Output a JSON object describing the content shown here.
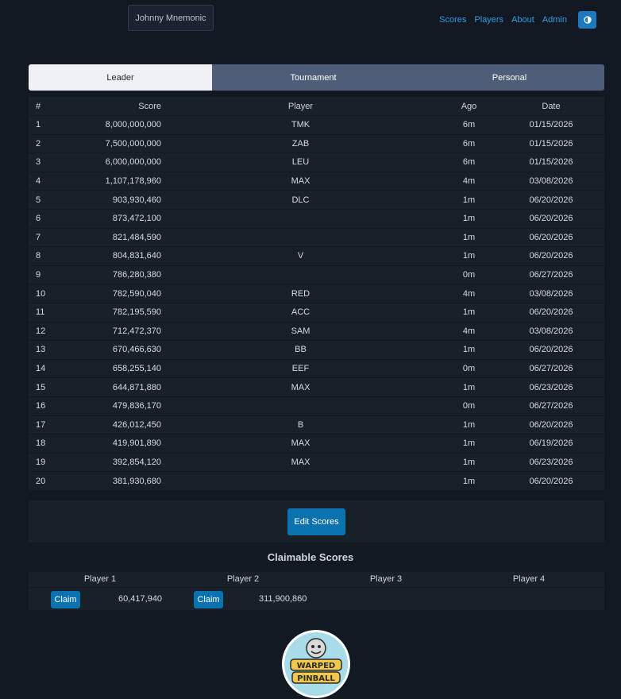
{
  "header": {
    "machine_name": "Johnny Mnemonic",
    "nav": [
      "Scores",
      "Players",
      "About",
      "Admin"
    ],
    "theme_icon": "half-circle-contrast-icon"
  },
  "tabs": [
    {
      "label": "Leader",
      "active": true
    },
    {
      "label": "Tournament",
      "active": false
    },
    {
      "label": "Personal",
      "active": false
    }
  ],
  "table": {
    "columns": [
      "#",
      "Score",
      "Player",
      "Ago",
      "Date"
    ],
    "rows": [
      [
        "1",
        "8,000,000,000",
        "TMK",
        "6m",
        "01/15/2026"
      ],
      [
        "2",
        "7,500,000,000",
        "ZAB",
        "6m",
        "01/15/2026"
      ],
      [
        "3",
        "6,000,000,000",
        "LEU",
        "6m",
        "01/15/2026"
      ],
      [
        "4",
        "1,107,178,960",
        "MAX",
        "4m",
        "03/08/2026"
      ],
      [
        "5",
        "903,930,460",
        "DLC",
        "1m",
        "06/20/2026"
      ],
      [
        "6",
        "873,472,100",
        "",
        "1m",
        "06/20/2026"
      ],
      [
        "7",
        "821,484,590",
        "",
        "1m",
        "06/20/2026"
      ],
      [
        "8",
        "804,831,640",
        "V",
        "1m",
        "06/20/2026"
      ],
      [
        "9",
        "786,280,380",
        "",
        "0m",
        "06/27/2026"
      ],
      [
        "10",
        "782,590,040",
        "RED",
        "4m",
        "03/08/2026"
      ],
      [
        "11",
        "782,195,590",
        "ACC",
        "1m",
        "06/20/2026"
      ],
      [
        "12",
        "712,472,370",
        "SAM",
        "4m",
        "03/08/2026"
      ],
      [
        "13",
        "670,466,630",
        "BB",
        "1m",
        "06/20/2026"
      ],
      [
        "14",
        "658,255,140",
        "EEF",
        "0m",
        "06/27/2026"
      ],
      [
        "15",
        "644,871,880",
        "MAX",
        "1m",
        "06/23/2026"
      ],
      [
        "16",
        "479,836,170",
        "",
        "0m",
        "06/27/2026"
      ],
      [
        "17",
        "426,012,450",
        "B",
        "1m",
        "06/20/2026"
      ],
      [
        "18",
        "419,901,890",
        "MAX",
        "1m",
        "06/19/2026"
      ],
      [
        "19",
        "392,854,120",
        "MAX",
        "1m",
        "06/23/2026"
      ],
      [
        "20",
        "381,930,680",
        "",
        "1m",
        "06/20/2026"
      ]
    ]
  },
  "edit_scores_label": "Edit Scores",
  "claimable": {
    "title": "Claimable Scores",
    "players": [
      "Player 1",
      "Player 2",
      "Player 3",
      "Player 4"
    ],
    "entries": [
      {
        "button": "Claim",
        "score": "60,417,940"
      },
      {
        "button": "Claim",
        "score": "311,900,860"
      }
    ]
  },
  "logo": {
    "text_line1": "WARPED",
    "text_line2": "PINBALL",
    "icon": "pinball-mascot-logo"
  },
  "colors": {
    "accent": "#0b72b0",
    "link": "#2f9ae0",
    "tab_inactive": "#4f5e78",
    "background": "#131923"
  }
}
